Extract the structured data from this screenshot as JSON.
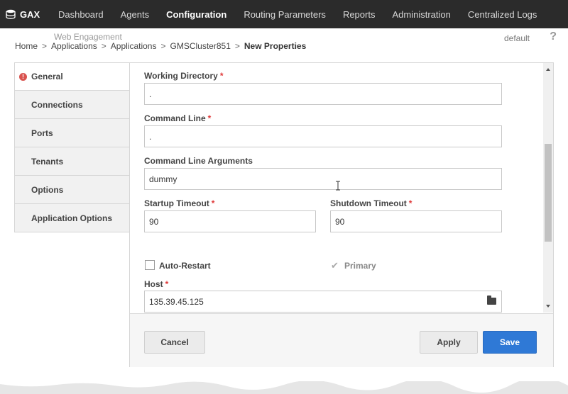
{
  "app": {
    "logo_text": "GAX"
  },
  "nav": {
    "items": [
      {
        "label": "Dashboard",
        "active": false
      },
      {
        "label": "Agents",
        "active": false
      },
      {
        "label": "Configuration",
        "active": true
      },
      {
        "label": "Routing Parameters",
        "active": false
      },
      {
        "label": "Reports",
        "active": false
      },
      {
        "label": "Administration",
        "active": false
      },
      {
        "label": "Centralized Logs",
        "active": false
      }
    ]
  },
  "header": {
    "sub_crumb": "Web Engagement",
    "tenant": "default",
    "help": "?",
    "breadcrumb": [
      "Home",
      "Applications",
      "Applications",
      "GMSCluster851",
      "New Properties"
    ],
    "separator": ">"
  },
  "sidebar": {
    "items": [
      {
        "label": "General",
        "error_icon": "!"
      },
      {
        "label": "Connections"
      },
      {
        "label": "Ports"
      },
      {
        "label": "Tenants"
      },
      {
        "label": "Options"
      },
      {
        "label": "Application Options"
      }
    ]
  },
  "form": {
    "working_directory": {
      "label": "Working Directory",
      "value": "."
    },
    "command_line": {
      "label": "Command Line",
      "value": "."
    },
    "command_line_args": {
      "label": "Command Line Arguments",
      "value": "dummy"
    },
    "startup_timeout": {
      "label": "Startup Timeout",
      "value": "90"
    },
    "shutdown_timeout": {
      "label": "Shutdown Timeout",
      "value": "90"
    },
    "auto_restart": {
      "label": "Auto-Restart",
      "checked": false
    },
    "primary": {
      "label": "Primary",
      "checked": true,
      "disabled": true
    },
    "host": {
      "label": "Host",
      "value": "135.39.45.125"
    },
    "required_mark": "*",
    "check_glyph": "✔"
  },
  "footer": {
    "cancel_label": "Cancel",
    "apply_label": "Apply",
    "save_label": "Save"
  },
  "colors": {
    "topbar": "#2b2b2b",
    "primary_button": "#2f79d6",
    "required": "#e03a3a",
    "error": "#d9534f"
  }
}
